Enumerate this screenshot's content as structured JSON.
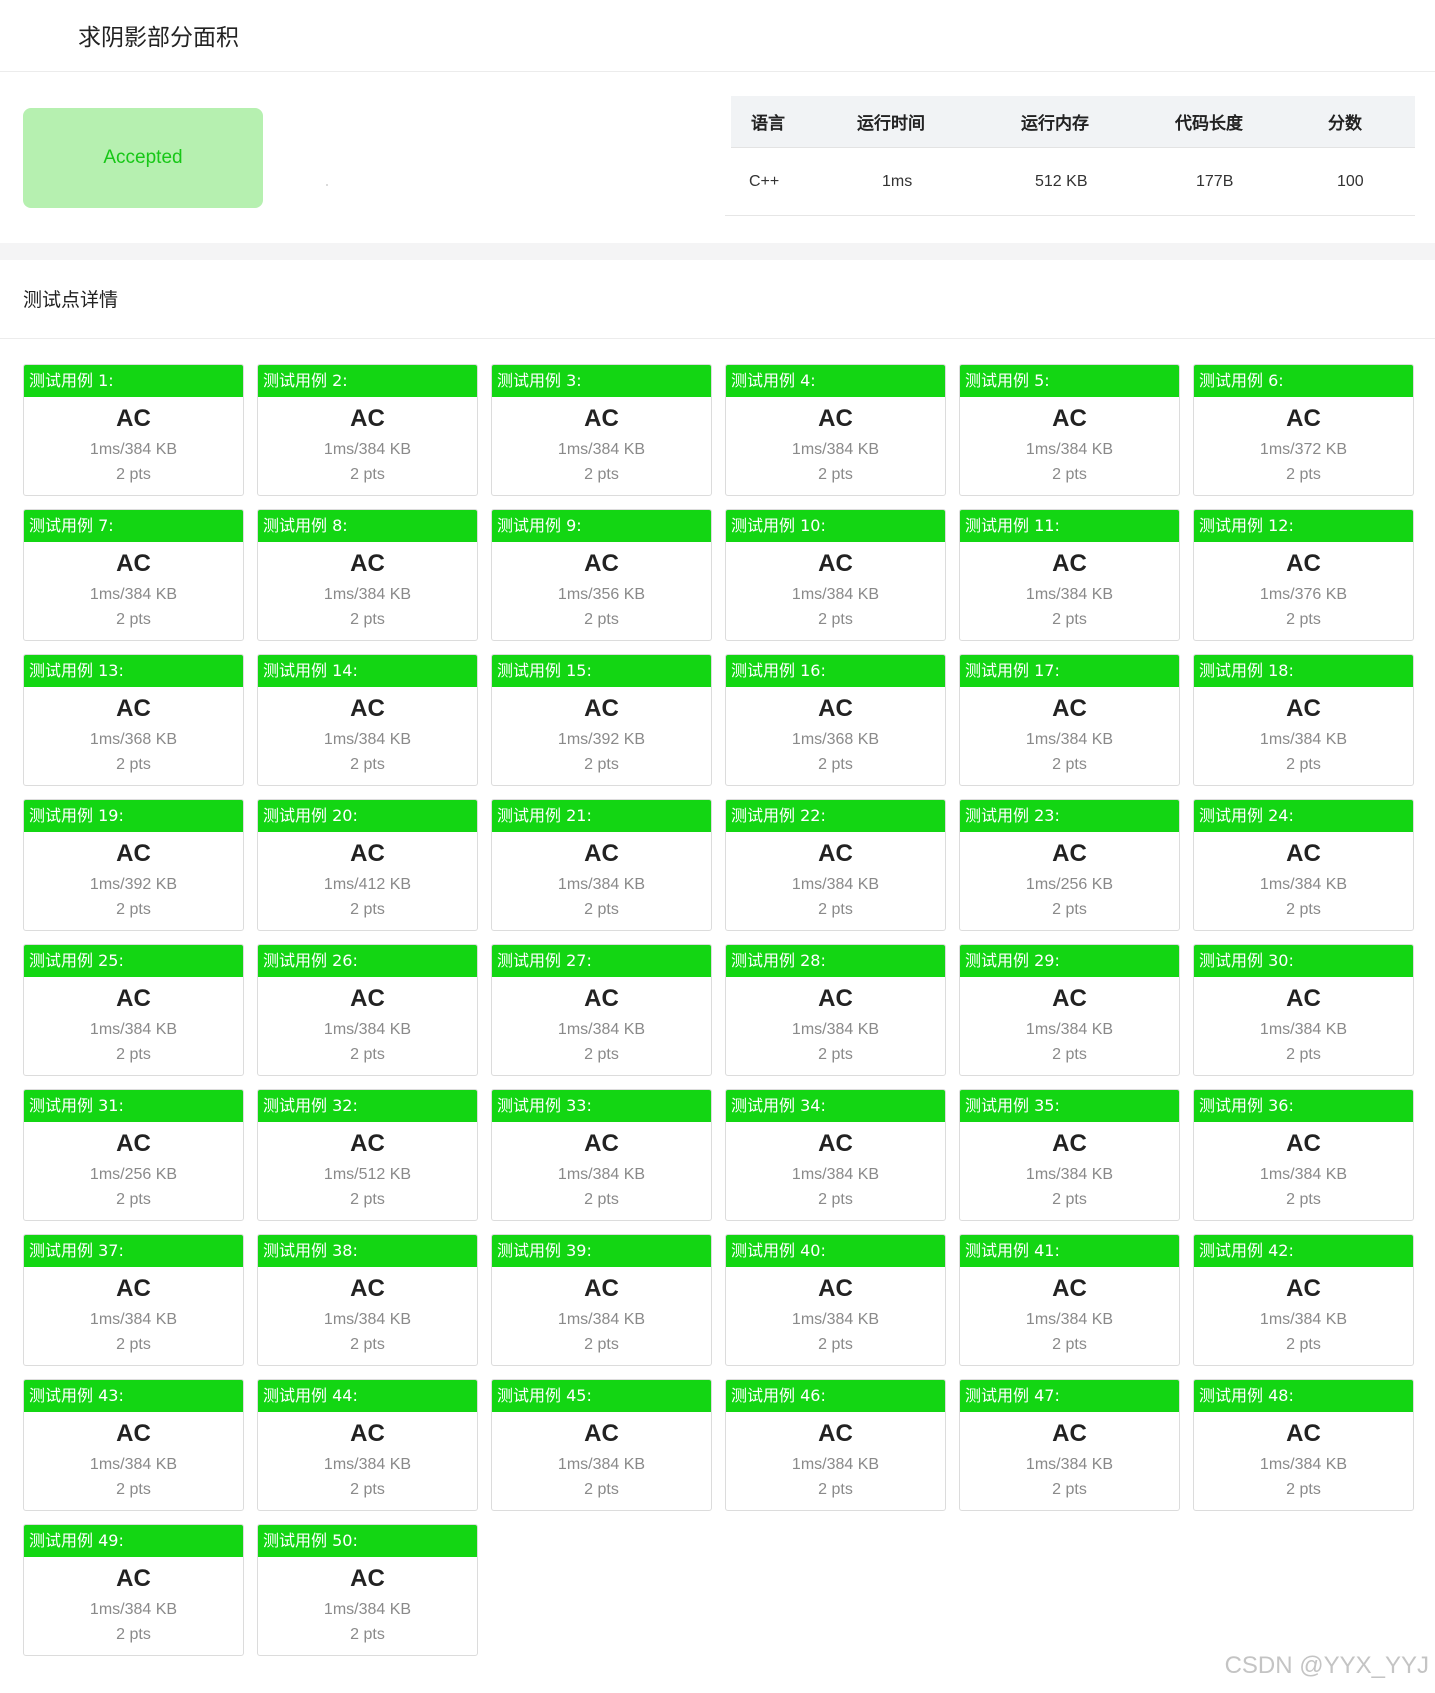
{
  "page": {
    "title": "求阴影部分面积"
  },
  "submission": {
    "status": "Accepted",
    "status_color": "#17c717",
    "status_bg": "#b6f0b0",
    "headers": [
      "语言",
      "运行时间",
      "运行内存",
      "代码长度",
      "分数"
    ],
    "values": [
      "C++",
      "1ms",
      "512 KB",
      "177B",
      "100"
    ]
  },
  "tests": {
    "section_title": "测试点详情",
    "accent": "#13d613",
    "cases": [
      {
        "label": "测试用例 1:",
        "status": "AC",
        "stat": "1ms/384 KB",
        "pts": "2 pts"
      },
      {
        "label": "测试用例 2:",
        "status": "AC",
        "stat": "1ms/384 KB",
        "pts": "2 pts"
      },
      {
        "label": "测试用例 3:",
        "status": "AC",
        "stat": "1ms/384 KB",
        "pts": "2 pts"
      },
      {
        "label": "测试用例 4:",
        "status": "AC",
        "stat": "1ms/384 KB",
        "pts": "2 pts"
      },
      {
        "label": "测试用例 5:",
        "status": "AC",
        "stat": "1ms/384 KB",
        "pts": "2 pts"
      },
      {
        "label": "测试用例 6:",
        "status": "AC",
        "stat": "1ms/372 KB",
        "pts": "2 pts"
      },
      {
        "label": "测试用例 7:",
        "status": "AC",
        "stat": "1ms/384 KB",
        "pts": "2 pts"
      },
      {
        "label": "测试用例 8:",
        "status": "AC",
        "stat": "1ms/384 KB",
        "pts": "2 pts"
      },
      {
        "label": "测试用例 9:",
        "status": "AC",
        "stat": "1ms/356 KB",
        "pts": "2 pts"
      },
      {
        "label": "测试用例 10:",
        "status": "AC",
        "stat": "1ms/384 KB",
        "pts": "2 pts"
      },
      {
        "label": "测试用例 11:",
        "status": "AC",
        "stat": "1ms/384 KB",
        "pts": "2 pts"
      },
      {
        "label": "测试用例 12:",
        "status": "AC",
        "stat": "1ms/376 KB",
        "pts": "2 pts"
      },
      {
        "label": "测试用例 13:",
        "status": "AC",
        "stat": "1ms/368 KB",
        "pts": "2 pts"
      },
      {
        "label": "测试用例 14:",
        "status": "AC",
        "stat": "1ms/384 KB",
        "pts": "2 pts"
      },
      {
        "label": "测试用例 15:",
        "status": "AC",
        "stat": "1ms/392 KB",
        "pts": "2 pts"
      },
      {
        "label": "测试用例 16:",
        "status": "AC",
        "stat": "1ms/368 KB",
        "pts": "2 pts"
      },
      {
        "label": "测试用例 17:",
        "status": "AC",
        "stat": "1ms/384 KB",
        "pts": "2 pts"
      },
      {
        "label": "测试用例 18:",
        "status": "AC",
        "stat": "1ms/384 KB",
        "pts": "2 pts"
      },
      {
        "label": "测试用例 19:",
        "status": "AC",
        "stat": "1ms/392 KB",
        "pts": "2 pts"
      },
      {
        "label": "测试用例 20:",
        "status": "AC",
        "stat": "1ms/412 KB",
        "pts": "2 pts"
      },
      {
        "label": "测试用例 21:",
        "status": "AC",
        "stat": "1ms/384 KB",
        "pts": "2 pts"
      },
      {
        "label": "测试用例 22:",
        "status": "AC",
        "stat": "1ms/384 KB",
        "pts": "2 pts"
      },
      {
        "label": "测试用例 23:",
        "status": "AC",
        "stat": "1ms/256 KB",
        "pts": "2 pts"
      },
      {
        "label": "测试用例 24:",
        "status": "AC",
        "stat": "1ms/384 KB",
        "pts": "2 pts"
      },
      {
        "label": "测试用例 25:",
        "status": "AC",
        "stat": "1ms/384 KB",
        "pts": "2 pts"
      },
      {
        "label": "测试用例 26:",
        "status": "AC",
        "stat": "1ms/384 KB",
        "pts": "2 pts"
      },
      {
        "label": "测试用例 27:",
        "status": "AC",
        "stat": "1ms/384 KB",
        "pts": "2 pts"
      },
      {
        "label": "测试用例 28:",
        "status": "AC",
        "stat": "1ms/384 KB",
        "pts": "2 pts"
      },
      {
        "label": "测试用例 29:",
        "status": "AC",
        "stat": "1ms/384 KB",
        "pts": "2 pts"
      },
      {
        "label": "测试用例 30:",
        "status": "AC",
        "stat": "1ms/384 KB",
        "pts": "2 pts"
      },
      {
        "label": "测试用例 31:",
        "status": "AC",
        "stat": "1ms/256 KB",
        "pts": "2 pts"
      },
      {
        "label": "测试用例 32:",
        "status": "AC",
        "stat": "1ms/512 KB",
        "pts": "2 pts"
      },
      {
        "label": "测试用例 33:",
        "status": "AC",
        "stat": "1ms/384 KB",
        "pts": "2 pts"
      },
      {
        "label": "测试用例 34:",
        "status": "AC",
        "stat": "1ms/384 KB",
        "pts": "2 pts"
      },
      {
        "label": "测试用例 35:",
        "status": "AC",
        "stat": "1ms/384 KB",
        "pts": "2 pts"
      },
      {
        "label": "测试用例 36:",
        "status": "AC",
        "stat": "1ms/384 KB",
        "pts": "2 pts"
      },
      {
        "label": "测试用例 37:",
        "status": "AC",
        "stat": "1ms/384 KB",
        "pts": "2 pts"
      },
      {
        "label": "测试用例 38:",
        "status": "AC",
        "stat": "1ms/384 KB",
        "pts": "2 pts"
      },
      {
        "label": "测试用例 39:",
        "status": "AC",
        "stat": "1ms/384 KB",
        "pts": "2 pts"
      },
      {
        "label": "测试用例 40:",
        "status": "AC",
        "stat": "1ms/384 KB",
        "pts": "2 pts"
      },
      {
        "label": "测试用例 41:",
        "status": "AC",
        "stat": "1ms/384 KB",
        "pts": "2 pts"
      },
      {
        "label": "测试用例 42:",
        "status": "AC",
        "stat": "1ms/384 KB",
        "pts": "2 pts"
      },
      {
        "label": "测试用例 43:",
        "status": "AC",
        "stat": "1ms/384 KB",
        "pts": "2 pts"
      },
      {
        "label": "测试用例 44:",
        "status": "AC",
        "stat": "1ms/384 KB",
        "pts": "2 pts"
      },
      {
        "label": "测试用例 45:",
        "status": "AC",
        "stat": "1ms/384 KB",
        "pts": "2 pts"
      },
      {
        "label": "测试用例 46:",
        "status": "AC",
        "stat": "1ms/384 KB",
        "pts": "2 pts"
      },
      {
        "label": "测试用例 47:",
        "status": "AC",
        "stat": "1ms/384 KB",
        "pts": "2 pts"
      },
      {
        "label": "测试用例 48:",
        "status": "AC",
        "stat": "1ms/384 KB",
        "pts": "2 pts"
      },
      {
        "label": "测试用例 49:",
        "status": "AC",
        "stat": "1ms/384 KB",
        "pts": "2 pts"
      },
      {
        "label": "测试用例 50:",
        "status": "AC",
        "stat": "1ms/384 KB",
        "pts": "2 pts"
      }
    ]
  },
  "watermark": "CSDN @YYX_YYJ"
}
